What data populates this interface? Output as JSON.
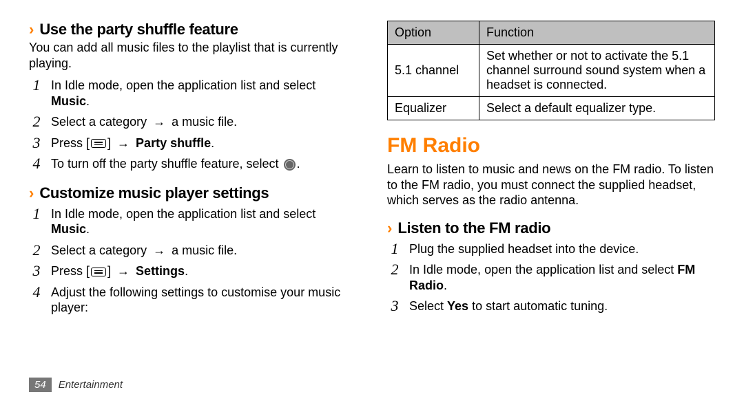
{
  "left": {
    "sub1": {
      "title": "Use the party shuffle feature",
      "intro": "You can add all music files to the playlist that is currently playing.",
      "steps": {
        "s1a": "In Idle mode, open the application list and select ",
        "s1b": "Music",
        "s2a": "Select a category ",
        "s2b": " a music file.",
        "s3a": "Press [",
        "s3b": "] ",
        "s3c": "Party shuffle",
        "s4a": "To turn off the party shuffle feature, select ",
        "s4b": "."
      }
    },
    "sub2": {
      "title": "Customize music player settings",
      "steps": {
        "s1a": "In Idle mode, open the application list and select ",
        "s1b": "Music",
        "s2a": "Select a category ",
        "s2b": " a music file.",
        "s3a": "Press [",
        "s3b": "] ",
        "s3c": "Settings",
        "s4": "Adjust the following settings to customise your music player:"
      }
    }
  },
  "right": {
    "table": {
      "h1": "Option",
      "h2": "Function",
      "r1c1": "5.1 channel",
      "r1c2": "Set whether or not to activate the 5.1 channel surround sound system when a headset is connected.",
      "r2c1": "Equalizer",
      "r2c2": "Select a default equalizer type."
    },
    "fm": {
      "title": "FM Radio",
      "intro": "Learn to listen to music and news on the FM radio. To listen to the FM radio, you must connect the supplied headset, which serves as the radio antenna.",
      "sub": "Listen to the FM radio",
      "s1": "Plug the supplied headset into the device.",
      "s2a": "In Idle mode, open the application list and select ",
      "s2b": "FM Radio",
      "s3a": "Select ",
      "s3b": "Yes",
      "s3c": " to start automatic tuning."
    }
  },
  "footer": {
    "page": "54",
    "category": "Entertainment"
  },
  "glyphs": {
    "arrow": "→",
    "chevron": "›",
    "period": "."
  }
}
